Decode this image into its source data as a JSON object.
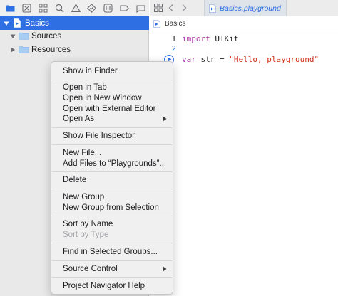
{
  "navigator": {
    "toolbar_icons": [
      "folder-icon",
      "source-control-icon",
      "symbol-icon",
      "search-icon",
      "issue-warning-icon",
      "test-diamond-icon",
      "debug-icon",
      "breakpoint-icon",
      "report-icon"
    ],
    "tree": [
      {
        "label": "Basics",
        "type": "playground",
        "selected": true,
        "expanded": true
      },
      {
        "label": "Sources",
        "type": "folder",
        "selected": false,
        "expanded": true
      },
      {
        "label": "Resources",
        "type": "folder",
        "selected": false,
        "expanded": false
      }
    ]
  },
  "editor": {
    "tab_title": "Basics.playground",
    "jumpbar_item": "Basics",
    "code": {
      "line1_number": "1",
      "line1_keyword": "import",
      "line1_rest": " UIKit",
      "line2_number": "2",
      "line3_keyword": "var",
      "line3_rest": " str = ",
      "line3_string": "\"Hello, playground\""
    }
  },
  "context_menu": {
    "items": [
      {
        "label": "Show in Finder",
        "enabled": true,
        "submenu": false
      },
      {
        "label": "Open in Tab",
        "enabled": true,
        "submenu": false
      },
      {
        "label": "Open in New Window",
        "enabled": true,
        "submenu": false
      },
      {
        "label": "Open with External Editor",
        "enabled": true,
        "submenu": false
      },
      {
        "label": "Open As",
        "enabled": true,
        "submenu": true
      },
      {
        "label": "Show File Inspector",
        "enabled": true,
        "submenu": false
      },
      {
        "label": "New File...",
        "enabled": true,
        "submenu": false
      },
      {
        "label": "Add Files to “Playgrounds”...",
        "enabled": true,
        "submenu": false
      },
      {
        "label": "Delete",
        "enabled": true,
        "submenu": false
      },
      {
        "label": "New Group",
        "enabled": true,
        "submenu": false
      },
      {
        "label": "New Group from Selection",
        "enabled": true,
        "submenu": false
      },
      {
        "label": "Sort by Name",
        "enabled": true,
        "submenu": false
      },
      {
        "label": "Sort by Type",
        "enabled": false,
        "submenu": false
      },
      {
        "label": "Find in Selected Groups...",
        "enabled": true,
        "submenu": false
      },
      {
        "label": "Source Control",
        "enabled": true,
        "submenu": true
      },
      {
        "label": "Project Navigator Help",
        "enabled": true,
        "submenu": false
      }
    ]
  },
  "colors": {
    "accent": "#2f6fe4",
    "keyword": "#ad3da4",
    "string": "#d12f1b",
    "disabled_text": "#a5a5a9"
  }
}
